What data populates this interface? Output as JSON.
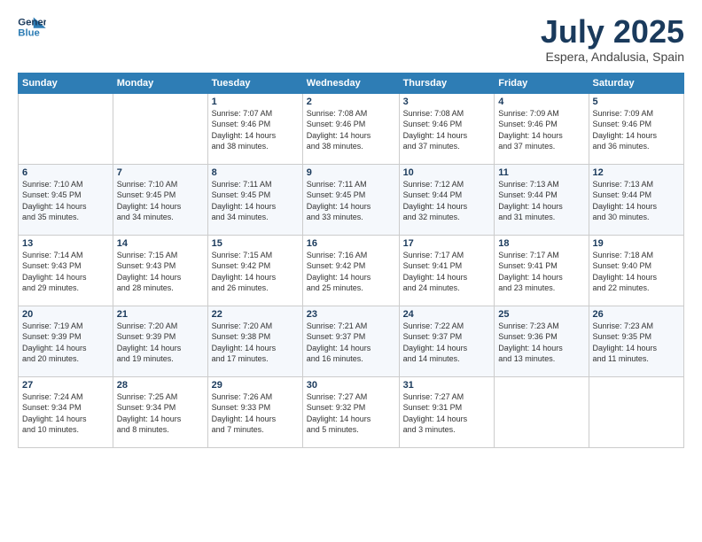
{
  "header": {
    "logo_line1": "General",
    "logo_line2": "Blue",
    "month": "July 2025",
    "location": "Espera, Andalusia, Spain"
  },
  "weekdays": [
    "Sunday",
    "Monday",
    "Tuesday",
    "Wednesday",
    "Thursday",
    "Friday",
    "Saturday"
  ],
  "weeks": [
    [
      {
        "day": null,
        "info": null
      },
      {
        "day": null,
        "info": null
      },
      {
        "day": "1",
        "info": "Sunrise: 7:07 AM\nSunset: 9:46 PM\nDaylight: 14 hours\nand 38 minutes."
      },
      {
        "day": "2",
        "info": "Sunrise: 7:08 AM\nSunset: 9:46 PM\nDaylight: 14 hours\nand 38 minutes."
      },
      {
        "day": "3",
        "info": "Sunrise: 7:08 AM\nSunset: 9:46 PM\nDaylight: 14 hours\nand 37 minutes."
      },
      {
        "day": "4",
        "info": "Sunrise: 7:09 AM\nSunset: 9:46 PM\nDaylight: 14 hours\nand 37 minutes."
      },
      {
        "day": "5",
        "info": "Sunrise: 7:09 AM\nSunset: 9:46 PM\nDaylight: 14 hours\nand 36 minutes."
      }
    ],
    [
      {
        "day": "6",
        "info": "Sunrise: 7:10 AM\nSunset: 9:45 PM\nDaylight: 14 hours\nand 35 minutes."
      },
      {
        "day": "7",
        "info": "Sunrise: 7:10 AM\nSunset: 9:45 PM\nDaylight: 14 hours\nand 34 minutes."
      },
      {
        "day": "8",
        "info": "Sunrise: 7:11 AM\nSunset: 9:45 PM\nDaylight: 14 hours\nand 34 minutes."
      },
      {
        "day": "9",
        "info": "Sunrise: 7:11 AM\nSunset: 9:45 PM\nDaylight: 14 hours\nand 33 minutes."
      },
      {
        "day": "10",
        "info": "Sunrise: 7:12 AM\nSunset: 9:44 PM\nDaylight: 14 hours\nand 32 minutes."
      },
      {
        "day": "11",
        "info": "Sunrise: 7:13 AM\nSunset: 9:44 PM\nDaylight: 14 hours\nand 31 minutes."
      },
      {
        "day": "12",
        "info": "Sunrise: 7:13 AM\nSunset: 9:44 PM\nDaylight: 14 hours\nand 30 minutes."
      }
    ],
    [
      {
        "day": "13",
        "info": "Sunrise: 7:14 AM\nSunset: 9:43 PM\nDaylight: 14 hours\nand 29 minutes."
      },
      {
        "day": "14",
        "info": "Sunrise: 7:15 AM\nSunset: 9:43 PM\nDaylight: 14 hours\nand 28 minutes."
      },
      {
        "day": "15",
        "info": "Sunrise: 7:15 AM\nSunset: 9:42 PM\nDaylight: 14 hours\nand 26 minutes."
      },
      {
        "day": "16",
        "info": "Sunrise: 7:16 AM\nSunset: 9:42 PM\nDaylight: 14 hours\nand 25 minutes."
      },
      {
        "day": "17",
        "info": "Sunrise: 7:17 AM\nSunset: 9:41 PM\nDaylight: 14 hours\nand 24 minutes."
      },
      {
        "day": "18",
        "info": "Sunrise: 7:17 AM\nSunset: 9:41 PM\nDaylight: 14 hours\nand 23 minutes."
      },
      {
        "day": "19",
        "info": "Sunrise: 7:18 AM\nSunset: 9:40 PM\nDaylight: 14 hours\nand 22 minutes."
      }
    ],
    [
      {
        "day": "20",
        "info": "Sunrise: 7:19 AM\nSunset: 9:39 PM\nDaylight: 14 hours\nand 20 minutes."
      },
      {
        "day": "21",
        "info": "Sunrise: 7:20 AM\nSunset: 9:39 PM\nDaylight: 14 hours\nand 19 minutes."
      },
      {
        "day": "22",
        "info": "Sunrise: 7:20 AM\nSunset: 9:38 PM\nDaylight: 14 hours\nand 17 minutes."
      },
      {
        "day": "23",
        "info": "Sunrise: 7:21 AM\nSunset: 9:37 PM\nDaylight: 14 hours\nand 16 minutes."
      },
      {
        "day": "24",
        "info": "Sunrise: 7:22 AM\nSunset: 9:37 PM\nDaylight: 14 hours\nand 14 minutes."
      },
      {
        "day": "25",
        "info": "Sunrise: 7:23 AM\nSunset: 9:36 PM\nDaylight: 14 hours\nand 13 minutes."
      },
      {
        "day": "26",
        "info": "Sunrise: 7:23 AM\nSunset: 9:35 PM\nDaylight: 14 hours\nand 11 minutes."
      }
    ],
    [
      {
        "day": "27",
        "info": "Sunrise: 7:24 AM\nSunset: 9:34 PM\nDaylight: 14 hours\nand 10 minutes."
      },
      {
        "day": "28",
        "info": "Sunrise: 7:25 AM\nSunset: 9:34 PM\nDaylight: 14 hours\nand 8 minutes."
      },
      {
        "day": "29",
        "info": "Sunrise: 7:26 AM\nSunset: 9:33 PM\nDaylight: 14 hours\nand 7 minutes."
      },
      {
        "day": "30",
        "info": "Sunrise: 7:27 AM\nSunset: 9:32 PM\nDaylight: 14 hours\nand 5 minutes."
      },
      {
        "day": "31",
        "info": "Sunrise: 7:27 AM\nSunset: 9:31 PM\nDaylight: 14 hours\nand 3 minutes."
      },
      {
        "day": null,
        "info": null
      },
      {
        "day": null,
        "info": null
      }
    ]
  ]
}
